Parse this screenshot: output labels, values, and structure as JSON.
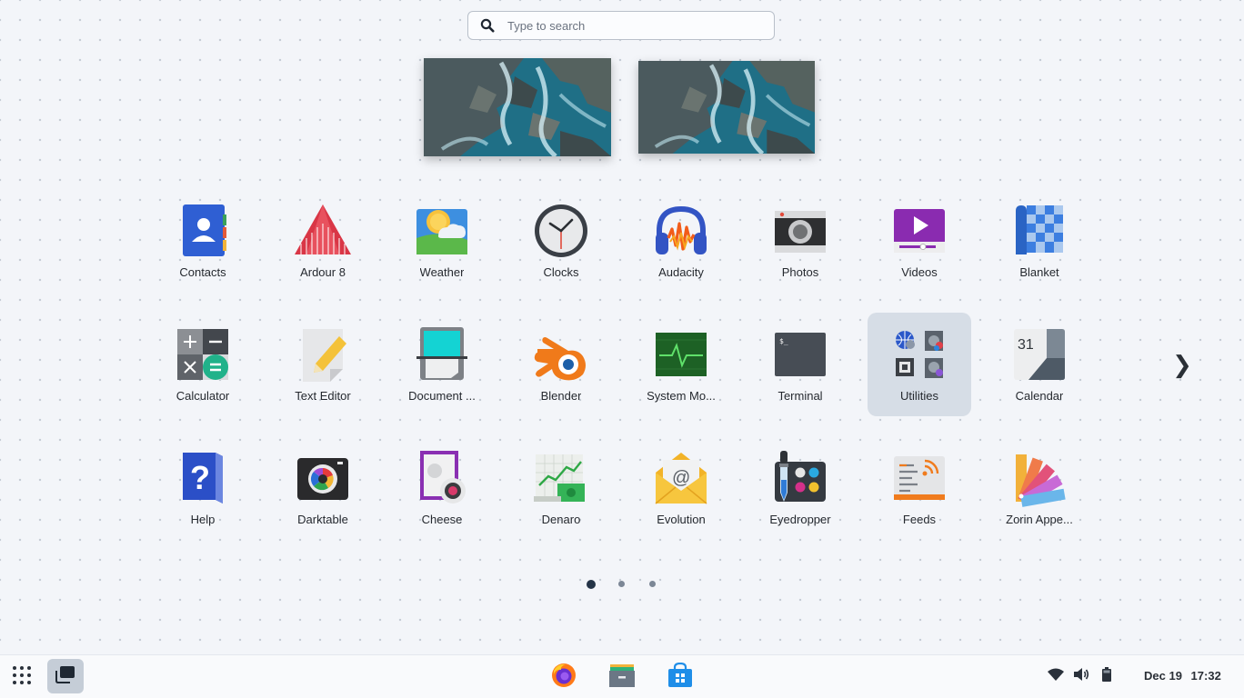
{
  "search": {
    "placeholder": "Type to search"
  },
  "apps": [
    {
      "name": "Contacts",
      "icon": "contacts-icon"
    },
    {
      "name": "Ardour 8",
      "icon": "ardour-icon"
    },
    {
      "name": "Weather",
      "icon": "weather-icon"
    },
    {
      "name": "Clocks",
      "icon": "clocks-icon"
    },
    {
      "name": "Audacity",
      "icon": "audacity-icon"
    },
    {
      "name": "Photos",
      "icon": "photos-icon"
    },
    {
      "name": "Videos",
      "icon": "videos-icon"
    },
    {
      "name": "Blanket",
      "icon": "blanket-icon"
    },
    {
      "name": "Calculator",
      "icon": "calculator-icon"
    },
    {
      "name": "Text Editor",
      "icon": "text-editor-icon"
    },
    {
      "name": "Document ...",
      "icon": "document-scanner-icon"
    },
    {
      "name": "Blender",
      "icon": "blender-icon"
    },
    {
      "name": "System Mo...",
      "icon": "system-monitor-icon"
    },
    {
      "name": "Terminal",
      "icon": "terminal-icon"
    },
    {
      "name": "Utilities",
      "icon": "utilities-folder-icon"
    },
    {
      "name": "Calendar",
      "icon": "calendar-icon",
      "day": "31"
    },
    {
      "name": "Help",
      "icon": "help-icon"
    },
    {
      "name": "Darktable",
      "icon": "darktable-icon"
    },
    {
      "name": "Cheese",
      "icon": "cheese-icon"
    },
    {
      "name": "Denaro",
      "icon": "denaro-icon"
    },
    {
      "name": "Evolution",
      "icon": "evolution-icon"
    },
    {
      "name": "Eyedropper",
      "icon": "eyedropper-icon"
    },
    {
      "name": "Feeds",
      "icon": "feeds-icon"
    },
    {
      "name": "Zorin Appe...",
      "icon": "zorin-appearance-icon"
    }
  ],
  "selected_app": "Utilities",
  "pagination": {
    "pages": 3,
    "current": 1
  },
  "next_arrow": "❯",
  "taskbar": {
    "apps": [
      "firefox-icon",
      "files-icon",
      "software-store-icon"
    ],
    "tray": [
      "wifi-icon",
      "volume-icon",
      "battery-icon"
    ],
    "date": "Dec 19",
    "time": "17:32"
  },
  "colors": {
    "accent": "#2a7fd4",
    "background": "#f3f5f9",
    "selected_tile": "#d6dde6"
  }
}
